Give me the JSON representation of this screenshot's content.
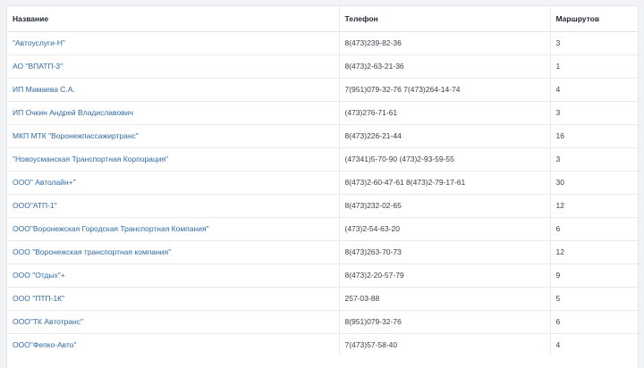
{
  "table": {
    "headers": {
      "name": "Название",
      "phone": "Телефон",
      "routes": "Маршрутов"
    },
    "rows": [
      {
        "name": "\"Автоуслуги-Н\"",
        "phone": "8(473)239-82-36",
        "routes": "3"
      },
      {
        "name": "АО \"ВПАТП-3\"",
        "phone": "8(473)2-63-21-36",
        "routes": "1"
      },
      {
        "name": "ИП Мамаева С.А.",
        "phone": "7(951)079-32-76 7(473)264-14-74",
        "routes": "4"
      },
      {
        "name": "ИП Очкин Андрей Владиславович",
        "phone": "(473)276-71-61",
        "routes": "3"
      },
      {
        "name": "МКП МТК \"Воронежпассажиртранс\"",
        "phone": "8(473)226-21-44",
        "routes": "16"
      },
      {
        "name": "\"Новоусманская Транспортная Корпорация\"",
        "phone": "(47341)5-70-90 (473)2-93-59-55",
        "routes": "3"
      },
      {
        "name": "ООО\" Автолайн+\"",
        "phone": "8(473)2-60-47-61 8(473)2-79-17-61",
        "routes": "30"
      },
      {
        "name": "ООО\"АТП-1\"",
        "phone": "8(473)232-02-65",
        "routes": "12"
      },
      {
        "name": "ООО\"Воронежская Городская Транспортная Компания\"",
        "phone": "(473)2-54-63-20",
        "routes": "6"
      },
      {
        "name": "ООО \"Воронежская транспортная компания\"",
        "phone": "8(473)263-70-73",
        "routes": "12"
      },
      {
        "name": "ООО \"Отдых\"+",
        "phone": "8(473)2-20-57-79",
        "routes": "9"
      },
      {
        "name": "ООО \"ПТП-1К\"",
        "phone": "257-03-88",
        "routes": "5"
      },
      {
        "name": "ООО\"ТК Автотранс\"",
        "phone": "8(951)079-32-76",
        "routes": "6"
      },
      {
        "name": "ООО\"Фепко-Авто\"",
        "phone": "7(473)57-58-40",
        "routes": "4"
      }
    ]
  }
}
